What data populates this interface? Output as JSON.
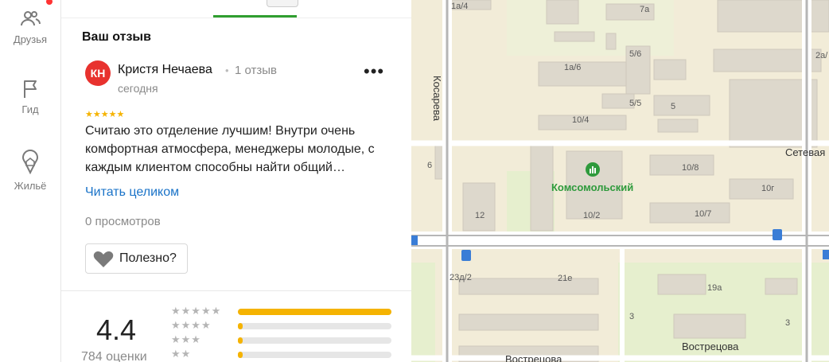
{
  "rail": {
    "items": [
      {
        "label": "Друзья"
      },
      {
        "label": "Гид"
      },
      {
        "label": "Жильё"
      }
    ]
  },
  "review": {
    "section_title": "Ваш отзыв",
    "avatar_initials": "КН",
    "author": "Кристя Нечаева",
    "author_reviews": "1 отзыв",
    "date": "сегодня",
    "more_label": "•••",
    "rating_stars": 5,
    "text": "Считаю это отделение лучшим! Внутри очень комфортная атмосфера, менеджеры молодые, с каждым клиентом способны найти общий…",
    "read_more": "Читать целиком",
    "views": "0 просмотров",
    "useful_label": "Полезно?"
  },
  "rating": {
    "value": "4.4",
    "count_label": "784 оценки",
    "distribution": [
      {
        "stars": 5,
        "fraction": 1.0
      },
      {
        "stars": 4,
        "fraction": 0.03
      },
      {
        "stars": 3,
        "fraction": 0.03
      },
      {
        "stars": 2,
        "fraction": 0.03
      }
    ]
  },
  "map": {
    "poi_name": "Комсомольский",
    "streets": [
      {
        "name": "Косарева"
      },
      {
        "name": "Сетевая"
      },
      {
        "name": "Вострецова"
      },
      {
        "name": "Вострецова"
      }
    ],
    "house_numbers": [
      "1а/4",
      "7а",
      "2а/",
      "1а/6",
      "5/6",
      "5/5",
      "5",
      "10/4",
      "6",
      "10/8",
      "10г",
      "12",
      "10/2",
      "10/7",
      "23д/2",
      "21е",
      "19а",
      "3",
      "3"
    ]
  },
  "colors": {
    "accent_green": "#2f9e2f",
    "star": "#f5b301",
    "link": "#1a73c8",
    "avatar": "#e8322e"
  }
}
